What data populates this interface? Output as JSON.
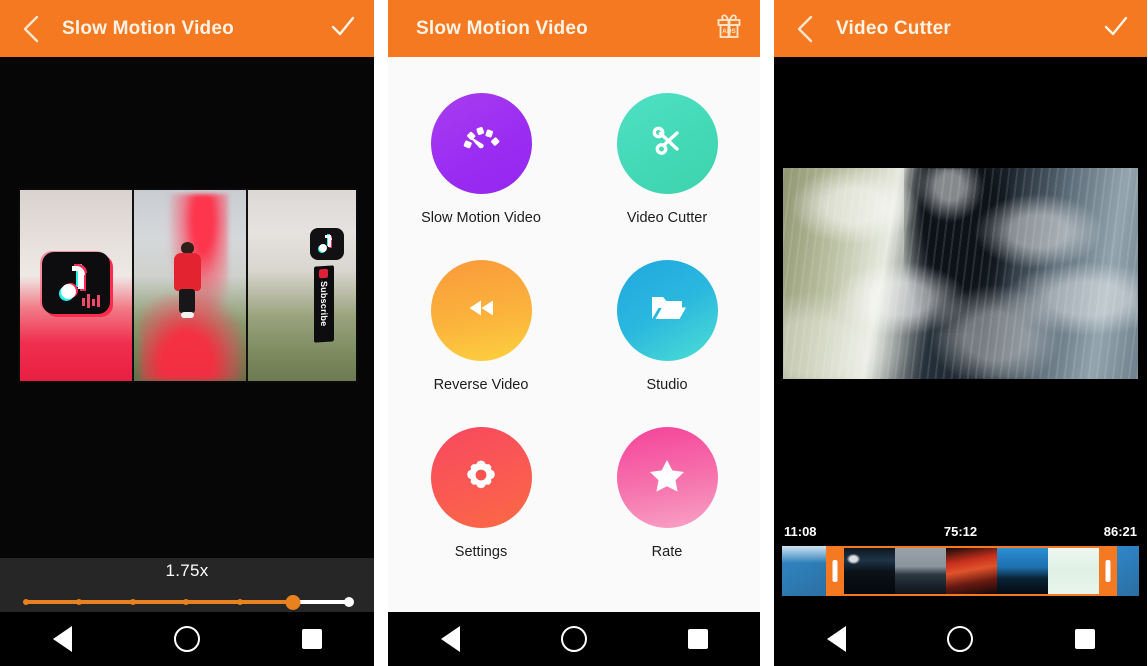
{
  "theme": {
    "accent_orange": "#F47920",
    "app_background": "#FAFAFA",
    "dark_panel": "#262626",
    "player_background": "#060606"
  },
  "screens": [
    {
      "id": "slow-motion-editor",
      "appbar": {
        "title": "Slow Motion Video",
        "back_icon": "chevron-left-icon",
        "action_icon": "check-icon"
      },
      "speed_control": {
        "value_label": "1.75x",
        "slider": {
          "fill_percent": 82.5,
          "tick_percents": [
            0,
            16.5,
            33,
            49.5,
            66,
            82.5,
            100
          ]
        }
      },
      "preview": {
        "subscribe_label": "Subscribe"
      }
    },
    {
      "id": "home",
      "appbar": {
        "title": "Slow Motion Video",
        "action_icon": "gift-ads-icon",
        "action_badge_text": "ADS"
      },
      "grid": [
        {
          "label": "Slow Motion Video",
          "icon": "speedometer-icon",
          "color_class": "c-slow"
        },
        {
          "label": "Video Cutter",
          "icon": "scissors-icon",
          "color_class": "c-cutter"
        },
        {
          "label": "Reverse Video",
          "icon": "rewind-icon",
          "color_class": "c-rev"
        },
        {
          "label": "Studio",
          "icon": "folder-open-icon",
          "color_class": "c-studio"
        },
        {
          "label": "Settings",
          "icon": "gear-icon",
          "color_class": "c-set"
        },
        {
          "label": "Rate",
          "icon": "star-icon",
          "color_class": "c-rate"
        }
      ]
    },
    {
      "id": "video-cutter",
      "appbar": {
        "title": "Video Cutter",
        "back_icon": "chevron-left-icon",
        "action_icon": "check-icon"
      },
      "timeline": {
        "start_time": "11:08",
        "current_time": "75:12",
        "end_time": "86:21"
      }
    }
  ],
  "navbar": {
    "back": "nav-back-icon",
    "home": "nav-home-icon",
    "recents": "nav-recents-icon"
  }
}
